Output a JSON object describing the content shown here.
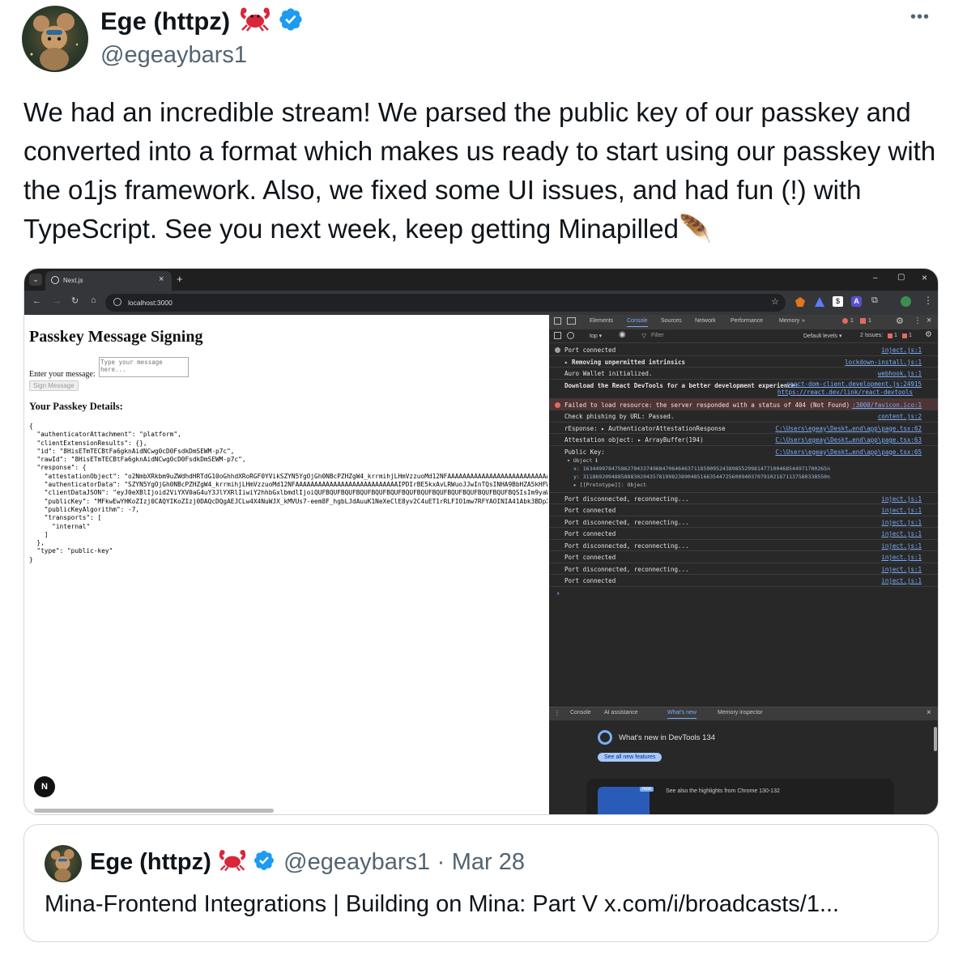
{
  "tweet": {
    "author_name": "Ege (httpz)",
    "handle": "@egeaybars1",
    "more_glyph": "•••",
    "text": "We had an incredible stream! We parsed the public key of our passkey and converted into a format which makes us ready to start using our passkey with the o1js framework. Also, we fixed some UI issues, and had fun (!) with TypeScript. See you next week, keep getting Minapilled",
    "text_emoji": "🪶"
  },
  "screenshot": {
    "browser": {
      "tab_title": "Next.js",
      "tab_close": "×",
      "new_tab": "+",
      "url": "localhost:3000",
      "window_min": "–",
      "window_max": "▢",
      "window_close": "×"
    },
    "page": {
      "heading": "Passkey Message Signing",
      "message_label": "Enter your message:",
      "message_placeholder": "Type your message here...",
      "sign_button": "Sign Message",
      "details_heading": "Your Passkey Details:",
      "json_lines": [
        "{",
        "  \"authenticatorAttachment\": \"platform\",",
        "  \"clientExtensionResults\": {},",
        "  \"id\": \"8HisETmTECBtFa6gknAidNCwg0cD0FsdkDmSEWM-p7c\",",
        "  \"rawId\": \"8HisETmTECBtFa6gknAidNCwg0cD0FsdkDmSEWM-p7c\",",
        "  \"response\": {",
        "    \"attestationObject\": \"o2NmbXRkbm9uZWdhdHRTdG10oGhhdXRoRGF0YVikSZYN5YgOjGh0NBcPZHZgW4_krrmihjLHmVzzuoMd12NFAAAAAAAAAAAAAAAAAAAAAAAAAAAAAAAAAAAAAA",
        "    \"authenticatorData\": \"SZYN5YgOjGh0NBcPZHZgW4_krrmihjLHmVzzuoMd12NFAAAAAAAAAAAAAAAAAAAAAAAAAAAIPDIrBE5kxAvLRWuoJJwInTQsINHA9BbHZA5kHFWbKzOQ",
        "    \"clientDataJSON\": \"eyJ0eXBlIjoid2ViYXV0aG4uY3JlYXRlIiwiY2hhbGxlbmdlIjoiQUFBQUFBQUFBQUFBQUFBQUFBQUFBQUFBQUFBQUFBQUFBQUFBQUFBQSIsIm9yaWdpbiI6",
        "    \"publicKey\": \"MFkwEwYHKoZIzj0CAQYIKoZIzj0DAQcDQgAEJCLw4X4NuWJX_kMVUs7-eem8F_hgbLJdAuuK1NeXeClE8yv2C4uET1rRLFIO1mw7RFYAOINIA41Abk3BDpXYyzw",
        "    \"publicKeyAlgorithm\": -7,",
        "    \"transports\": [",
        "      \"internal\"",
        "    ]",
        "  },",
        "  \"type\": \"public-key\"",
        "}"
      ],
      "nextjs_badge": "N"
    },
    "devtools": {
      "tabs": [
        "Elements",
        "Console",
        "Sources",
        "Network",
        "Performance",
        "Memory",
        "»"
      ],
      "active_tab": "Console",
      "error_count": "1",
      "warning_count": "1",
      "toolbar": {
        "context": "top ▾",
        "filter_placeholder": "Filter",
        "levels": "Default levels ▾",
        "issues": "2 Issues:",
        "issue_err": "1",
        "issue_warn": "1"
      },
      "log": [
        {
          "msg": "Port connected",
          "src": "inject.js:1"
        },
        {
          "msg": "▸ Removing unpermitted intrinsics",
          "src": "lockdown-install.js:1"
        },
        {
          "msg": "Auro Wallet initialized.",
          "src": "webhook.js:1"
        },
        {
          "msg": "Download the React DevTools for a better development experience:",
          "link": "https://react.dev/link/react-devtools",
          "src": "react-dom-client.development.js:24915"
        },
        {
          "msg": "Failed to load resource: the server responded with a status of 404 (Not Found)",
          "src": ":3000/favicon.ico:1"
        },
        {
          "msg": "Check phishing by URL: Passed.",
          "src": "content.js:2"
        },
        {
          "msg": "rEsponse:   ▸ AuthenticatorAttestationResponse",
          "src": "C:\\Users\\egeay\\Deskt…end\\app\\page.tsx:62"
        },
        {
          "msg": "Attestation object:   ▸ ArrayBuffer(194)",
          "src": "C:\\Users\\egeay\\Deskt…end\\app\\page.tsx:63"
        },
        {
          "msg": "Public Key:",
          "src": "C:\\Users\\egeay\\Deskt…end\\app\\page.tsx:65"
        }
      ],
      "object_lines": [
        "▾ Object ℹ",
        "x: 16344997847586279433749684706464637118590952438985529981477100468544971700265n",
        "y: 31186920948858883020435781998238904851663544725600940370791021671137580338550n",
        "▸ [[Prototype]]: Object"
      ],
      "port_log": [
        {
          "msg": "Port disconnected, reconnecting...",
          "src": "inject.js:1"
        },
        {
          "msg": "Port connected",
          "src": "inject.js:1"
        },
        {
          "msg": "Port disconnected, reconnecting...",
          "src": "inject.js:1"
        },
        {
          "msg": "Port connected",
          "src": "inject.js:1"
        },
        {
          "msg": "Port disconnected, reconnecting...",
          "src": "inject.js:1"
        },
        {
          "msg": "Port connected",
          "src": "inject.js:1"
        },
        {
          "msg": "Port disconnected, reconnecting...",
          "src": "inject.js:1"
        },
        {
          "msg": "Port connected",
          "src": "inject.js:1"
        }
      ],
      "prompt": "›",
      "drawer": {
        "tabs": [
          "Console",
          "AI assistance",
          "What's new",
          "Memory inspector"
        ],
        "active": "What's new",
        "title": "What's new in DevTools 134",
        "button": "See all new features",
        "badge": "new",
        "highlight": "See also the highlights from Chrome 130-132"
      }
    }
  },
  "quote": {
    "author_name": "Ege (httpz)",
    "handle": "@egeaybars1",
    "separator": "·",
    "date": "Mar 28",
    "text": "Mina-Frontend Integrations | Building on Mina: Part V x.com/i/broadcasts/1..."
  },
  "colors": {
    "verified": "#1d9bf0",
    "text": "#0f1419",
    "secondary": "#536471",
    "border": "#cfd9de",
    "devtools_bg": "#282828",
    "browser_chrome": "#35363a"
  }
}
